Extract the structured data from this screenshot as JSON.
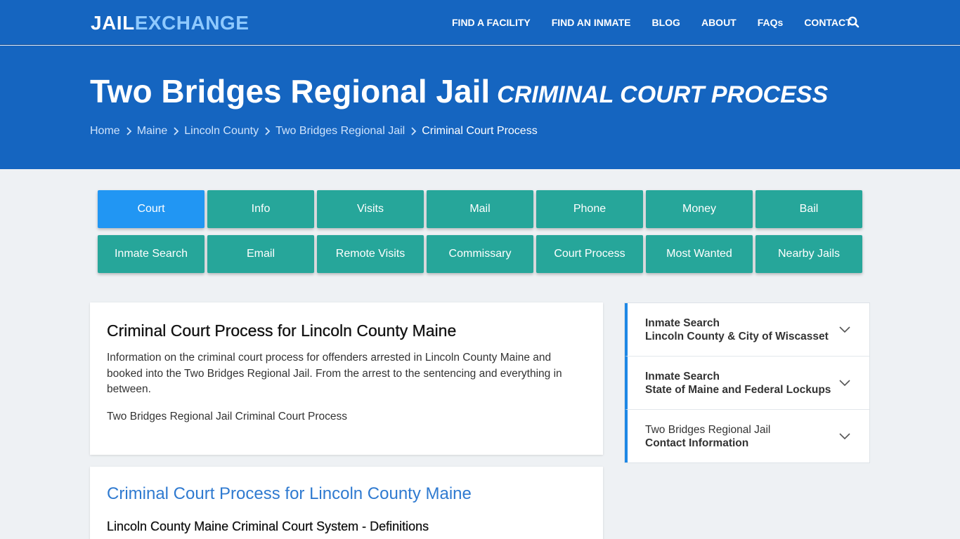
{
  "brand": {
    "part1": "JAIL",
    "part2": "EXCHANGE"
  },
  "nav": {
    "links": [
      "FIND A FACILITY",
      "FIND AN INMATE",
      "BLOG",
      "ABOUT",
      "FAQs",
      "CONTACT"
    ],
    "search_icon": "search-icon"
  },
  "hero": {
    "title": "Two Bridges Regional Jail",
    "subtitle": "CRIMINAL COURT PROCESS",
    "breadcrumb": [
      "Home",
      "Maine",
      "Lincoln County",
      "Two Bridges Regional Jail",
      "Criminal Court Process"
    ]
  },
  "tabs": {
    "row1": [
      "Court",
      "Info",
      "Visits",
      "Mail",
      "Phone",
      "Money",
      "Bail"
    ],
    "row2": [
      "Inmate Search",
      "Email",
      "Remote Visits",
      "Commissary",
      "Court Process",
      "Most Wanted",
      "Nearby Jails"
    ],
    "active": "Court"
  },
  "intro": {
    "heading": "Criminal Court Process for Lincoln County Maine",
    "paragraph": "Information on the criminal court process for offenders arrested in Lincoln County Maine and booked into the Two Bridges Regional Jail. From the arrest to the sentencing and everything in between.",
    "caption": "Two Bridges Regional Jail Criminal Court Process"
  },
  "section": {
    "heading": "Criminal Court Process for Lincoln County Maine",
    "subheading": "Lincoln County Maine Criminal Court System - Definitions"
  },
  "sidebar": {
    "items": [
      {
        "line1": "Inmate Search",
        "line2": "Lincoln County & City of Wiscasset"
      },
      {
        "line1": "Inmate Search",
        "line2": "State of Maine and Federal Lockups"
      },
      {
        "line1": "Two Bridges Regional Jail",
        "line2": "Contact Information"
      }
    ]
  },
  "colors": {
    "nav_bg": "#1565c0",
    "tab_bg": "#26a69a",
    "tab_active": "#2196f3",
    "link_blue": "#2f7ad0",
    "sidebar_accent": "#1e88e5"
  }
}
